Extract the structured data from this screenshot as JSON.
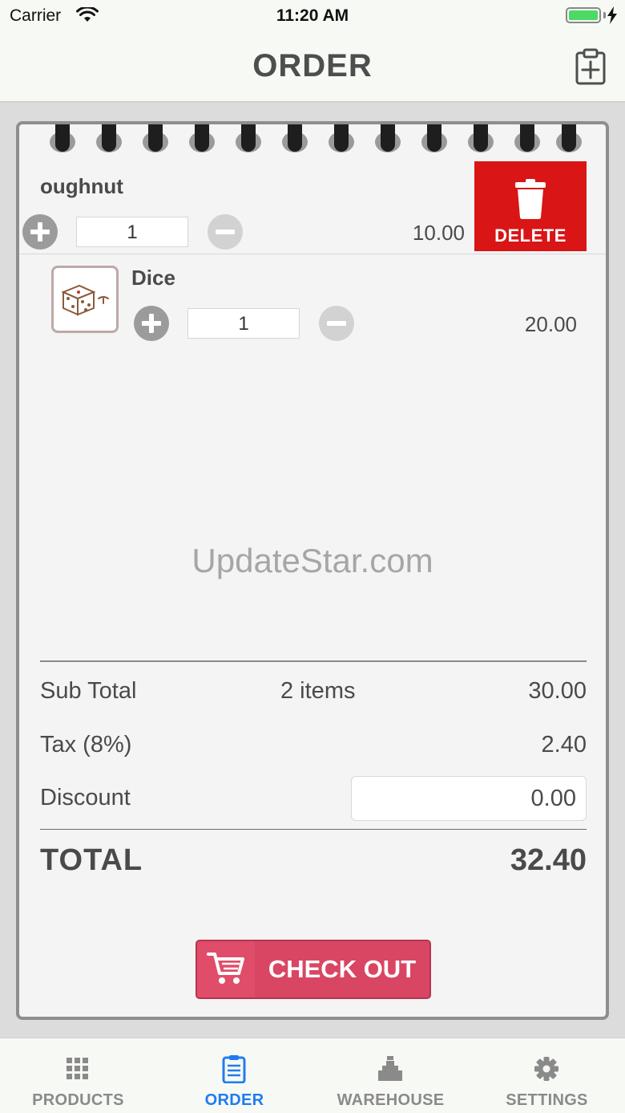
{
  "status_bar": {
    "carrier": "Carrier",
    "time": "11:20 AM"
  },
  "nav": {
    "title": "ORDER",
    "add_icon": "clipboard-plus-icon"
  },
  "order_items": [
    {
      "name": "oughnut",
      "quantity": "1",
      "price": "10.00",
      "delete_label": "DELETE"
    },
    {
      "name": "Dice",
      "quantity": "1",
      "price": "20.00",
      "thumbnail_icon": "dice-icon"
    }
  ],
  "watermark": "UpdateStar.com",
  "summary": {
    "subtotal_label": "Sub Total",
    "item_count": "2 items",
    "subtotal_value": "30.00",
    "tax_label": "Tax (8%)",
    "tax_value": "2.40",
    "discount_label": "Discount",
    "discount_value": "0.00",
    "total_label": "TOTAL",
    "total_value": "32.40"
  },
  "checkout": {
    "label": "CHECK OUT",
    "icon": "cart-icon",
    "color": "#d94663"
  },
  "tabs": [
    {
      "label": "PRODUCTS",
      "icon": "grid-icon",
      "active": false
    },
    {
      "label": "ORDER",
      "icon": "clipboard-list-icon",
      "active": true
    },
    {
      "label": "WAREHOUSE",
      "icon": "warehouse-icon",
      "active": false
    },
    {
      "label": "SETTINGS",
      "icon": "gear-icon",
      "active": false
    }
  ],
  "colors": {
    "accent": "#1f7cf0",
    "delete": "#d91515"
  }
}
